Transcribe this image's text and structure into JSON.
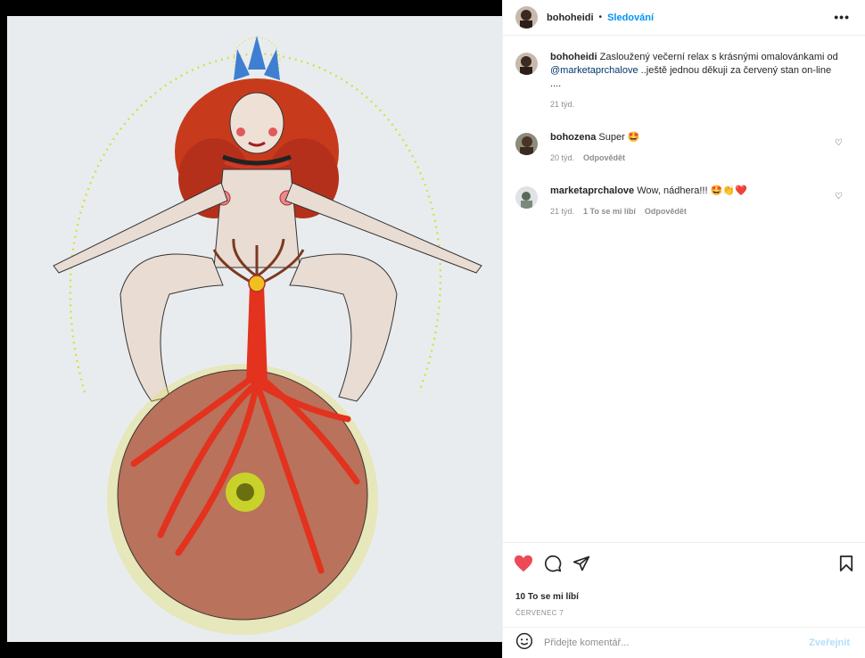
{
  "post": {
    "username": "bohoheidi",
    "separator": "•",
    "follow_label": "Sledování",
    "more_label": "•••"
  },
  "caption": {
    "username": "bohoheidi",
    "text_before": "Zasloužený večerní relax s krásnými omalovánkami od",
    "mention": "@marketaprchalove",
    "text_after": "..ještě jednou děkuji za červený stan on-line ....",
    "time": "21 týd."
  },
  "comments": [
    {
      "username": "bohozena",
      "text": "Super 🤩",
      "time": "20 týd.",
      "reply_label": "Odpovědět"
    },
    {
      "username": "marketaprchalove",
      "text": "Wow, nádhera!!! 🤩👏❤️",
      "time": "21 týd.",
      "likes_label": "1 To se mi líbí",
      "reply_label": "Odpovědět"
    }
  ],
  "icons": {
    "like": "heart-filled-icon",
    "comment": "comment-bubble-icon",
    "share": "paper-plane-icon",
    "save": "bookmark-icon",
    "emoji": "smiley-icon",
    "comment_like": "heart-outline-icon"
  },
  "stats": {
    "likes": "10 To se mi líbí",
    "date": "ČERVENEC 7"
  },
  "add_comment": {
    "placeholder": "Přidejte komentář...",
    "post_label": "Zveřejnit"
  },
  "colors": {
    "accent": "#0095f6",
    "like_red": "#ed4956",
    "post_disabled": "#b2dffc"
  }
}
